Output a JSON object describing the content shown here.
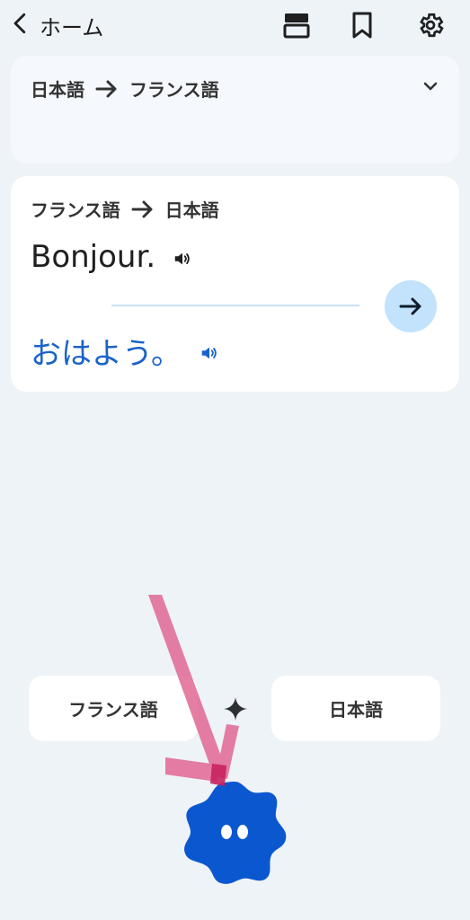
{
  "topbar": {
    "back_label": "ホーム",
    "icons": [
      "layout-icon",
      "bookmark-icon",
      "gear-icon"
    ]
  },
  "lang_card": {
    "from": "日本語",
    "to": "フランス語"
  },
  "translation_card": {
    "from": "フランス語",
    "to": "日本語",
    "source_text": "Bonjour.",
    "result_text": "おはよう。"
  },
  "bottom": {
    "left_lang": "フランス語",
    "right_lang": "日本語"
  },
  "colors": {
    "background": "#eef3f8",
    "accent_blue": "#0b57d0",
    "result_blue": "#1a63c9",
    "pointer_pink": "#e05a8a"
  }
}
